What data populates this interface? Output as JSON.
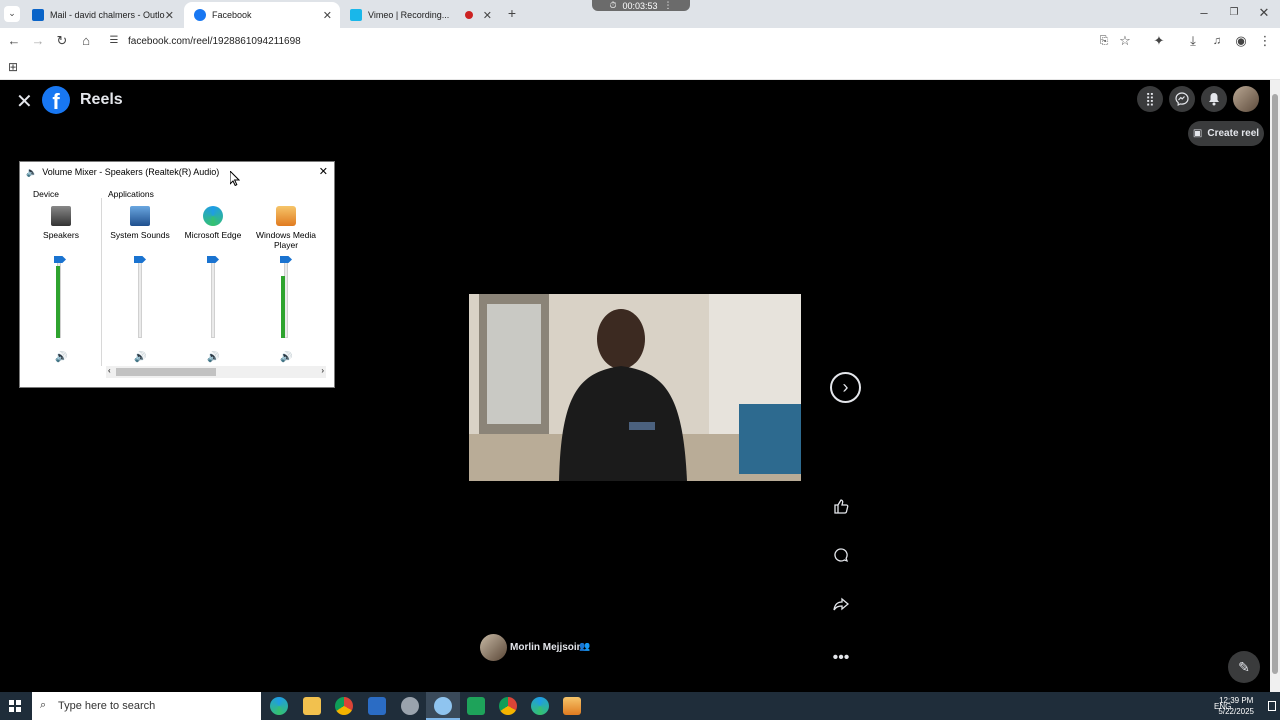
{
  "recording": {
    "time": "00:03:53"
  },
  "tabs": [
    {
      "title": "Mail - david chalmers - Outlook",
      "icon": "outlook-icon",
      "color": "#0a64c8"
    },
    {
      "title": "Facebook",
      "icon": "facebook-icon",
      "color": "#1877f2"
    },
    {
      "title": "Vimeo | Recording...",
      "icon": "vimeo-icon",
      "color": "#19b7ea"
    }
  ],
  "address_bar": {
    "url": "facebook.com/reel/1928861094211698"
  },
  "facebook": {
    "page_title": "Reels",
    "create_reel_label": "Create reel",
    "author_name": "Morlin Mejjsoin",
    "brand_color": "#1877f2"
  },
  "volume_mixer": {
    "title": "Volume Mixer - Speakers (Realtek(R) Audio)",
    "device_header": "Device",
    "applications_header": "Applications",
    "channels": [
      {
        "name": "Speakers",
        "level": 0.95,
        "active": true
      },
      {
        "name": "System Sounds",
        "level": 0.95,
        "active": false
      },
      {
        "name": "Microsoft Edge",
        "level": 0.95,
        "active": false
      },
      {
        "name": "Windows Media Player",
        "level": 0.95,
        "active": true
      }
    ]
  },
  "taskbar": {
    "search_placeholder": "Type here to search",
    "lang": "ENG",
    "time": "12:39 PM",
    "date": "5/22/2025"
  }
}
